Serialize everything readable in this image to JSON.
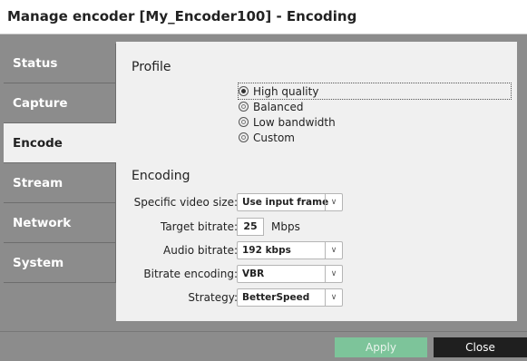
{
  "window": {
    "title": "Manage encoder [My_Encoder100] - Encoding"
  },
  "sidebar": {
    "items": [
      {
        "label": "Status"
      },
      {
        "label": "Capture"
      },
      {
        "label": "Encode"
      },
      {
        "label": "Stream"
      },
      {
        "label": "Network"
      },
      {
        "label": "System"
      }
    ],
    "active": "Encode"
  },
  "profile": {
    "heading": "Profile",
    "options": [
      "High quality",
      "Balanced",
      "Low bandwidth",
      "Custom"
    ],
    "selected": "High quality"
  },
  "encoding": {
    "heading": "Encoding",
    "video_size": {
      "label": "Specific video size:",
      "value": "Use input frame"
    },
    "target_bitrate": {
      "label": "Target bitrate:",
      "value": "25",
      "unit": "Mbps"
    },
    "audio_bitrate": {
      "label": "Audio bitrate:",
      "value": "192 kbps"
    },
    "bitrate_encoding": {
      "label": "Bitrate encoding:",
      "value": "VBR"
    },
    "strategy": {
      "label": "Strategy:",
      "value": "BetterSpeed"
    }
  },
  "footer": {
    "apply_label": "Apply",
    "close_label": "Close"
  },
  "colors": {
    "accent_apply": "#7dc49a",
    "sidebar_bg": "#8c8c8c",
    "close_bg": "#1f1f1f"
  }
}
